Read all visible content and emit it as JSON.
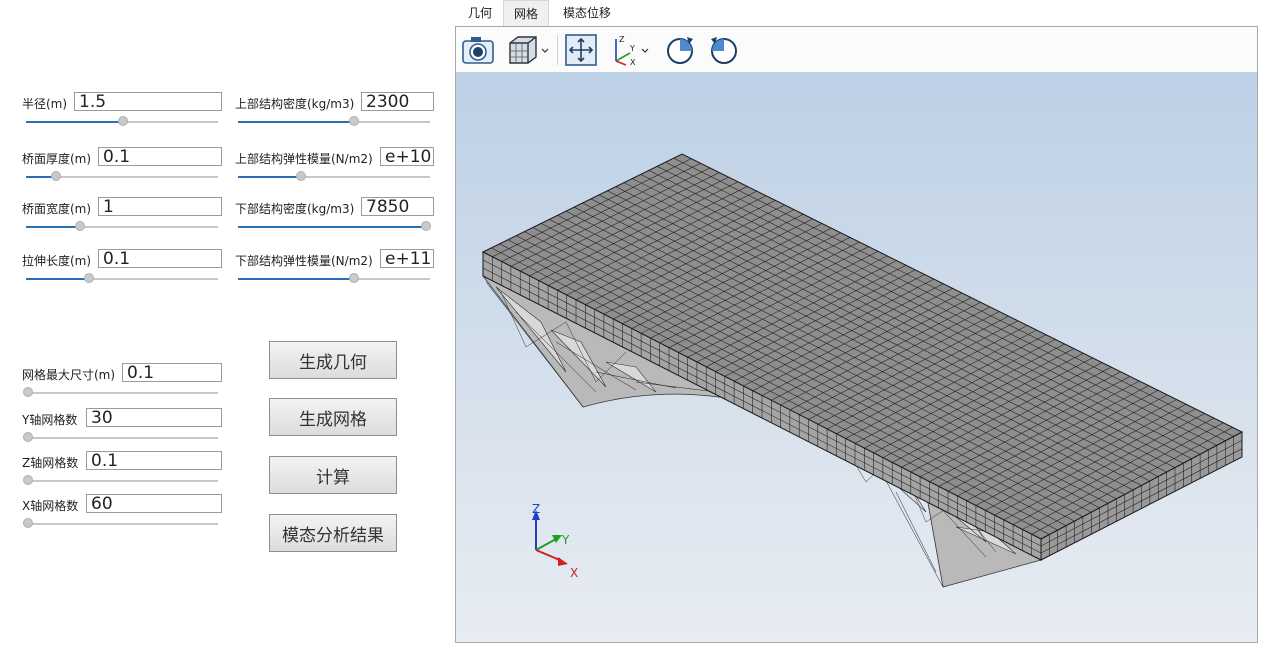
{
  "params_left": [
    {
      "label": "半径(m)",
      "value": "1.5",
      "slider": 0.45
    },
    {
      "label": "桥面厚度(m)",
      "value": "0.1",
      "slider": 0.15
    },
    {
      "label": "桥面宽度(m)",
      "value": "1",
      "slider": 0.28
    },
    {
      "label": "拉伸长度(m)",
      "value": "0.1",
      "slider": 0.33
    }
  ],
  "params_right": [
    {
      "label": "上部结构密度(kg/m3)",
      "value": "2300",
      "slider": 0.6
    },
    {
      "label": "上部结构弹性模量(N/m2)",
      "value": "e+10",
      "slider": 0.33
    },
    {
      "label": "下部结构密度(kg/m3)",
      "value": "7850",
      "slider": 1.0
    },
    {
      "label": "下部结构弹性模量(N/m2)",
      "value": "e+11",
      "slider": 0.6
    }
  ],
  "mesh_params": [
    {
      "label": "网格最大尺寸(m)",
      "value": "0.1",
      "slider": 0.0
    },
    {
      "label": "Y轴网格数",
      "value": "30",
      "slider": 0.0
    },
    {
      "label": "Z轴网格数",
      "value": "0.1",
      "slider": 0.0
    },
    {
      "label": "X轴网格数",
      "value": "60",
      "slider": 0.0
    }
  ],
  "buttons": {
    "gen_geometry": "生成几何",
    "gen_mesh": "生成网格",
    "compute": "计算",
    "modal_result": "模态分析结果"
  },
  "tabs": [
    "几何",
    "网格",
    "模态位移"
  ],
  "active_tab": 1,
  "axes": {
    "z": "Z",
    "y": "Y",
    "x": "X"
  },
  "toolbar_axes": {
    "z": "Z",
    "y": "Y",
    "x": "X"
  },
  "colors": {
    "slider_fill": "#2a6fb5",
    "mesh_top": "#8e8e8e",
    "mesh_edge": "#1a1a1a",
    "axis_x": "#d02020",
    "axis_y": "#20a020",
    "axis_z": "#2040c0"
  }
}
